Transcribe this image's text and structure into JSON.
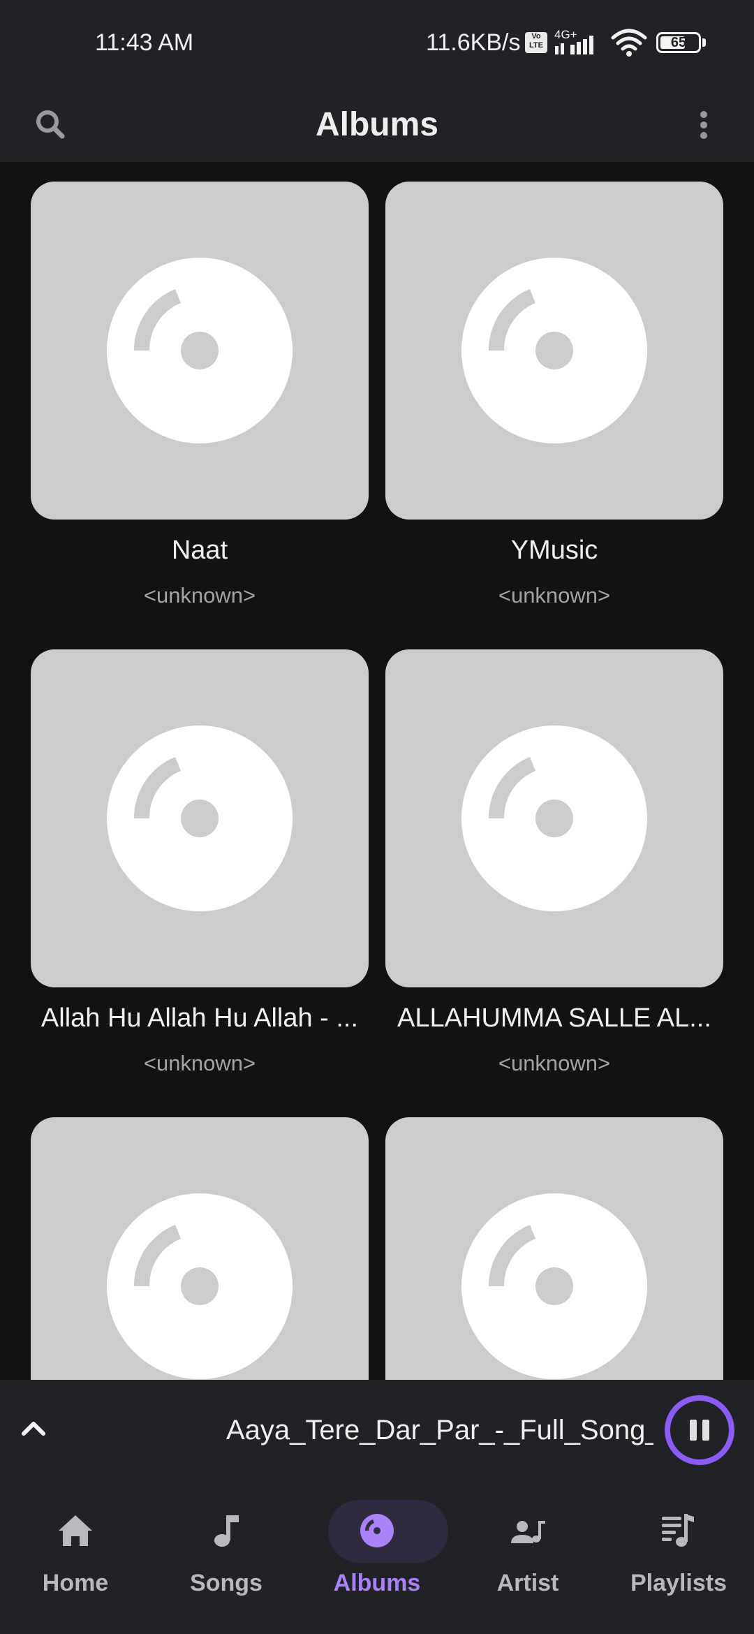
{
  "status_bar": {
    "time": "11:43 AM",
    "net_speed": "11.6KB/s",
    "volte_label": "Vo LTE",
    "network_type": "4G+",
    "battery_level": "65"
  },
  "app_bar": {
    "title": "Albums"
  },
  "albums": [
    {
      "title": "Naat",
      "artist": "<unknown>"
    },
    {
      "title": "YMusic",
      "artist": "<unknown>"
    },
    {
      "title": "Allah Hu Allah Hu Allah - ...",
      "artist": "<unknown>"
    },
    {
      "title": "ALLAHUMMA SALLE AL...",
      "artist": "<unknown>"
    },
    {
      "title": "",
      "artist": ""
    },
    {
      "title": "",
      "artist": ""
    }
  ],
  "mini_player": {
    "track_title": "Aaya_Tere_Dar_Par_-_Full_Song__\\",
    "state": "playing"
  },
  "bottom_nav": {
    "items": [
      {
        "label": "Home",
        "icon": "home-icon"
      },
      {
        "label": "Songs",
        "icon": "music-note-icon"
      },
      {
        "label": "Albums",
        "icon": "album-icon",
        "active": true
      },
      {
        "label": "Artist",
        "icon": "artist-icon"
      },
      {
        "label": "Playlists",
        "icon": "playlist-icon"
      }
    ]
  },
  "colors": {
    "background": "#121213",
    "surface": "#212226",
    "accent": "#a982f8",
    "accent_ring": "#8b5cf6",
    "placeholder": "#cccccc"
  }
}
